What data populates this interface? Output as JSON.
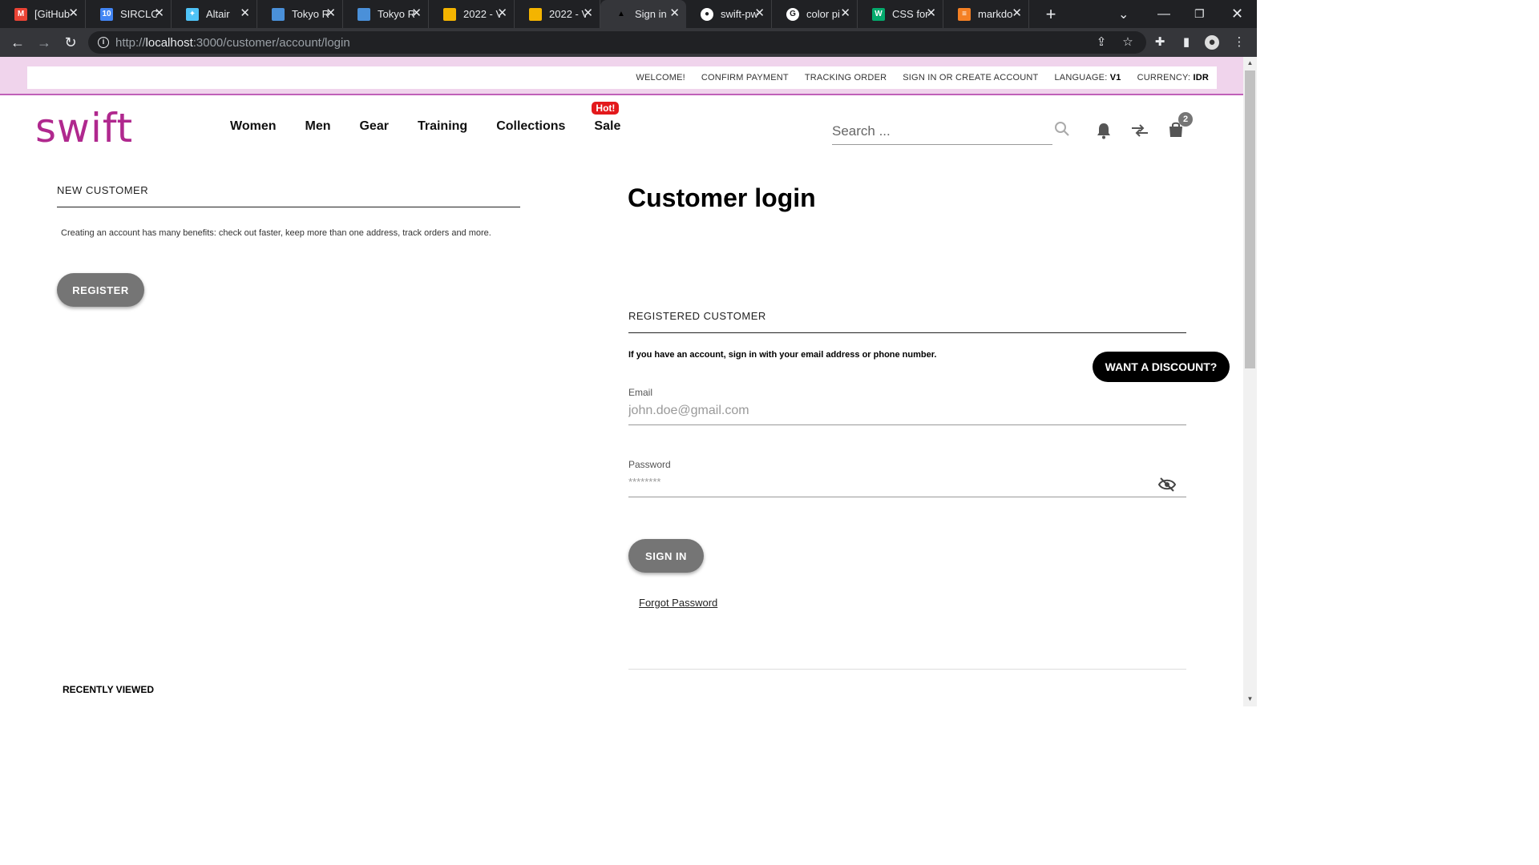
{
  "browser": {
    "tabs": [
      {
        "title": "[GitHub",
        "favicon": "gmail-icon",
        "color": "#ea4335",
        "glyph": "M"
      },
      {
        "title": "SIRCLO",
        "favicon": "calendar-icon",
        "color": "#4285f4",
        "glyph": "10"
      },
      {
        "title": "Altair",
        "favicon": "altair-icon",
        "color": "#4fc3f7",
        "glyph": "✦"
      },
      {
        "title": "Tokyo R",
        "favicon": "doc-icon",
        "color": "#4a90d9",
        "glyph": ""
      },
      {
        "title": "Tokyo R",
        "favicon": "doc-icon",
        "color": "#4a90d9",
        "glyph": ""
      },
      {
        "title": "2022 - V",
        "favicon": "slides-icon",
        "color": "#f4b400",
        "glyph": ""
      },
      {
        "title": "2022 - V",
        "favicon": "slides-icon",
        "color": "#f4b400",
        "glyph": ""
      },
      {
        "title": "Sign in",
        "favicon": "swift-tab-icon",
        "color": "#35363a",
        "glyph": "▲",
        "active": true
      },
      {
        "title": "swift-pw",
        "favicon": "github-icon",
        "color": "#ffffff",
        "glyph": "●"
      },
      {
        "title": "color pi",
        "favicon": "google-icon",
        "color": "#ffffff",
        "glyph": "G"
      },
      {
        "title": "CSS for",
        "favicon": "w3-icon",
        "color": "#04aa6d",
        "glyph": "W"
      },
      {
        "title": "markdo",
        "favicon": "stackoverflow-icon",
        "color": "#f48024",
        "glyph": "≡"
      }
    ],
    "url_scheme": "http://",
    "url_host": "localhost",
    "url_path": ":3000/customer/account/login"
  },
  "topbar": {
    "links": [
      "WELCOME!",
      "CONFIRM PAYMENT",
      "TRACKING ORDER",
      "SIGN IN OR CREATE ACCOUNT"
    ],
    "language_label": "LANGUAGE:",
    "language_value": "V1",
    "currency_label": "CURRENCY:",
    "currency_value": "IDR"
  },
  "header": {
    "logo": "swift",
    "nav": [
      "Women",
      "Men",
      "Gear",
      "Training",
      "Collections",
      "Sale"
    ],
    "hot_badge": "Hot!",
    "search_placeholder": "Search ...",
    "cart_count": "2"
  },
  "new_customer": {
    "heading": "NEW CUSTOMER",
    "text": "Creating an account has many benefits: check out faster, keep more than one address, track orders and more.",
    "register_label": "REGISTER"
  },
  "login": {
    "title": "Customer login",
    "heading": "REGISTERED CUSTOMER",
    "intro": "If you have an account, sign in with your email address or phone number.",
    "email_label": "Email",
    "email_placeholder": "john.doe@gmail.com",
    "password_label": "Password",
    "password_placeholder": "********",
    "signin_label": "SIGN IN",
    "forgot_label": "Forgot Password"
  },
  "discount_label": "WANT A DISCOUNT?",
  "recently_viewed": "RECENTLY VIEWED",
  "colors": {
    "brand": "#b0288e",
    "topstrip": "#f0d4ec",
    "hot": "#e3191c",
    "button": "#757575"
  }
}
